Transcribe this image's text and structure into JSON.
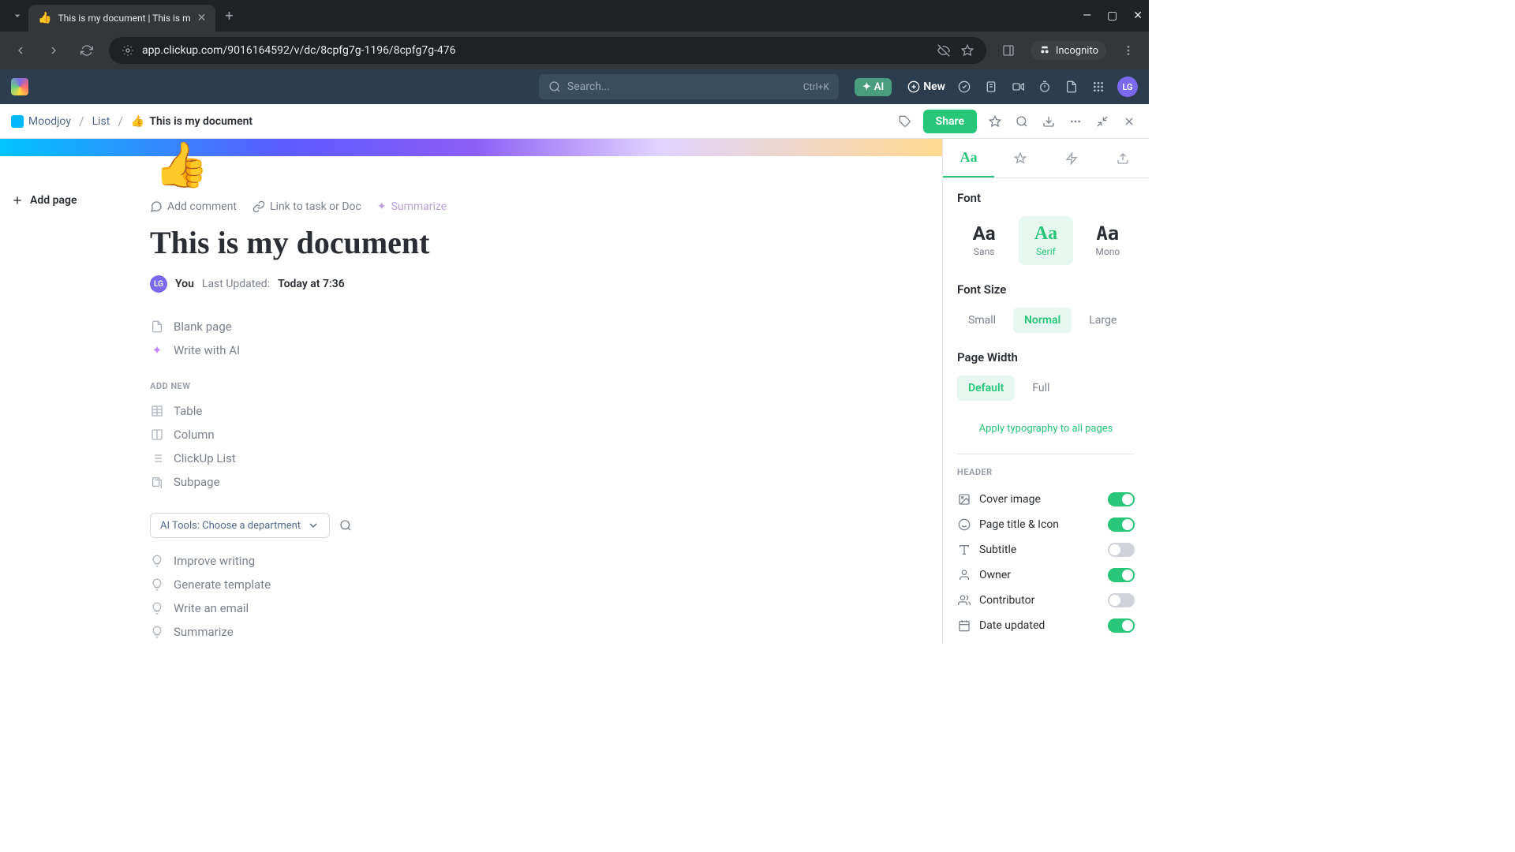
{
  "browser": {
    "tab_title": "This is my document | This is m",
    "tab_favicon": "👍",
    "url": "app.clickup.com/9016164592/v/dc/8cpfg7g-1196/8cpfg7g-476",
    "incognito_label": "Incognito"
  },
  "app_header": {
    "search_placeholder": "Search...",
    "search_shortcut": "Ctrl+K",
    "ai_label": "AI",
    "new_label": "New",
    "avatar_initials": "LG"
  },
  "breadcrumb": {
    "workspace": "Moodjoy",
    "list": "List",
    "doc_emoji": "👍",
    "doc_name": "This is my document",
    "share_label": "Share"
  },
  "left": {
    "add_page": "Add page"
  },
  "doc": {
    "emoji": "👍",
    "actions": {
      "add_comment": "Add comment",
      "link_task": "Link to task or Doc",
      "summarize": "Summarize"
    },
    "title": "This is my document",
    "meta": {
      "avatar": "LG",
      "you": "You",
      "updated_label": "Last Updated:",
      "updated_value": "Today at 7:36"
    },
    "starters": [
      {
        "icon": "page",
        "label": "Blank page"
      },
      {
        "icon": "sparkle",
        "label": "Write with AI"
      }
    ],
    "add_new_label": "ADD NEW",
    "add_new": [
      {
        "icon": "table",
        "label": "Table"
      },
      {
        "icon": "column",
        "label": "Column"
      },
      {
        "icon": "list",
        "label": "ClickUp List"
      },
      {
        "icon": "subpage",
        "label": "Subpage"
      }
    ],
    "ai_tools_label": "AI Tools: Choose a department",
    "ai_items": [
      "Improve writing",
      "Generate template",
      "Write an email",
      "Summarize"
    ]
  },
  "panel": {
    "tab_active": "Aa",
    "font": {
      "title": "Font",
      "options": [
        {
          "key": "sans",
          "aa": "Aa",
          "label": "Sans",
          "selected": false
        },
        {
          "key": "serif",
          "aa": "Aa",
          "label": "Serif",
          "selected": true
        },
        {
          "key": "mono",
          "aa": "Aa",
          "label": "Mono",
          "selected": false
        }
      ]
    },
    "font_size": {
      "title": "Font Size",
      "options": [
        {
          "label": "Small",
          "selected": false
        },
        {
          "label": "Normal",
          "selected": true
        },
        {
          "label": "Large",
          "selected": false
        }
      ]
    },
    "page_width": {
      "title": "Page Width",
      "options": [
        {
          "label": "Default",
          "selected": true
        },
        {
          "label": "Full",
          "selected": false
        }
      ]
    },
    "apply_all": "Apply typography to all pages",
    "header_section": "HEADER",
    "toggles": [
      {
        "icon": "image",
        "label": "Cover image",
        "on": true
      },
      {
        "icon": "smile",
        "label": "Page title & Icon",
        "on": true
      },
      {
        "icon": "text",
        "label": "Subtitle",
        "on": false
      },
      {
        "icon": "user",
        "label": "Owner",
        "on": true
      },
      {
        "icon": "users",
        "label": "Contributor",
        "on": false
      },
      {
        "icon": "calendar",
        "label": "Date updated",
        "on": true
      }
    ]
  }
}
